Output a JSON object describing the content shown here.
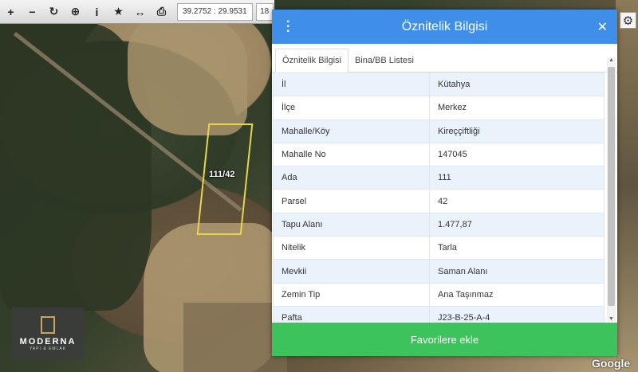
{
  "toolbar": {
    "tools": [
      {
        "name": "zoom-in-icon",
        "glyph": "+"
      },
      {
        "name": "zoom-out-icon",
        "glyph": "−"
      },
      {
        "name": "refresh-icon",
        "glyph": "↻"
      },
      {
        "name": "locate-icon",
        "glyph": "⊕"
      },
      {
        "name": "info-icon",
        "glyph": "i"
      },
      {
        "name": "star-icon",
        "glyph": "★"
      },
      {
        "name": "measure-icon",
        "glyph": "↔"
      },
      {
        "name": "print-icon",
        "glyph": "⎙"
      }
    ],
    "coordinates": "39.2752 : 29.9531",
    "zoom": "18"
  },
  "map": {
    "parcel_label": "111/42"
  },
  "logo": {
    "name": "MODERNA",
    "sub": "YAPI & EMLAK"
  },
  "google": "Google",
  "modal": {
    "title": "Öznitelik Bilgisi",
    "tabs": [
      "Öznitelik Bilgisi",
      "Bina/BB Listesi"
    ],
    "rows": [
      {
        "key": "İl",
        "value": "Kütahya"
      },
      {
        "key": "İlçe",
        "value": "Merkez"
      },
      {
        "key": "Mahalle/Köy",
        "value": "Kireççiftliği"
      },
      {
        "key": "Mahalle No",
        "value": "147045"
      },
      {
        "key": "Ada",
        "value": "111"
      },
      {
        "key": "Parsel",
        "value": "42"
      },
      {
        "key": "Tapu Alanı",
        "value": "1.477,87"
      },
      {
        "key": "Nitelik",
        "value": "Tarla"
      },
      {
        "key": "Mevkii",
        "value": "Saman Alanı"
      },
      {
        "key": "Zemin Tip",
        "value": "Ana Taşınmaz"
      },
      {
        "key": "Pafta",
        "value": "J23-B-25-A-4"
      }
    ],
    "favorite_button": "Favorilere ekle"
  }
}
